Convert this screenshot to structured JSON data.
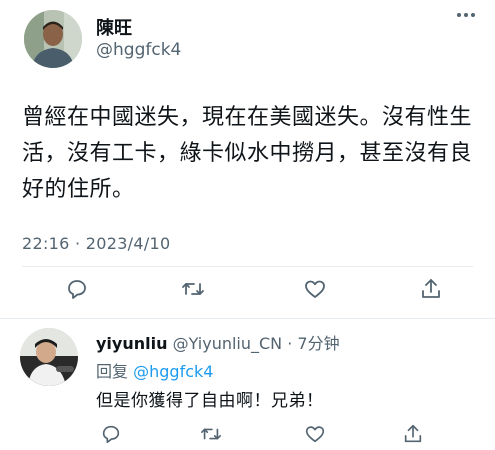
{
  "tweet": {
    "author_name": "陳旺",
    "author_handle": "@hggfck4",
    "text": "曾經在中國迷失，現在在美國迷失。沒有性生活，沒有工卡，綠卡似水中撈月，甚至沒有良好的住所。",
    "timestamp": "22:16 · 2023/4/10",
    "actions": [
      "reply-icon",
      "retweet-icon",
      "like-icon",
      "share-icon"
    ],
    "more_icon": "more-icon"
  },
  "reply": {
    "author_name": "yiyunliu",
    "author_handle": "@Yiyunliu_CN",
    "separator": " · ",
    "time_ago": "7分钟",
    "reply_to_label": "回复",
    "reply_to_handle": "@hggfck4",
    "text": "但是你獲得了自由啊！兄弟！",
    "actions": [
      "reply-icon",
      "retweet-icon",
      "like-icon",
      "share-icon"
    ]
  },
  "colors": {
    "text": "#0f1419",
    "secondary": "#536471",
    "link": "#1d9bf0",
    "divider": "#e6ecf0"
  }
}
